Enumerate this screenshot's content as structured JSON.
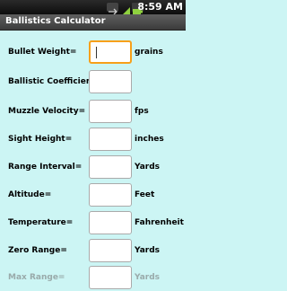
{
  "status_bar": {
    "time": "8:59 AM",
    "icons": [
      "usb-icon",
      "signal-icon",
      "battery-icon"
    ]
  },
  "app": {
    "title": "Ballistics Calculator"
  },
  "form": {
    "rows": [
      {
        "label": "Bullet Weight=",
        "unit": "grains",
        "value": ""
      },
      {
        "label": "Ballistic Coefficient=",
        "unit": "",
        "value": ""
      },
      {
        "label": "Muzzle Velocity=",
        "unit": "fps",
        "value": ""
      },
      {
        "label": "Sight Height=",
        "unit": "inches",
        "value": ""
      },
      {
        "label": "Range Interval=",
        "unit": "Yards",
        "value": ""
      },
      {
        "label": "Altitude=",
        "unit": "Feet",
        "value": ""
      },
      {
        "label": "Temperature=",
        "unit": "Fahrenheit",
        "value": ""
      },
      {
        "label": "Zero Range=",
        "unit": "Yards",
        "value": ""
      },
      {
        "label": "Max Range=",
        "unit": "Yards",
        "value": ""
      }
    ]
  },
  "colors": {
    "background": "#ccf5f4",
    "focus": "#f7a01a",
    "title_bar": "#4a4a4a"
  }
}
